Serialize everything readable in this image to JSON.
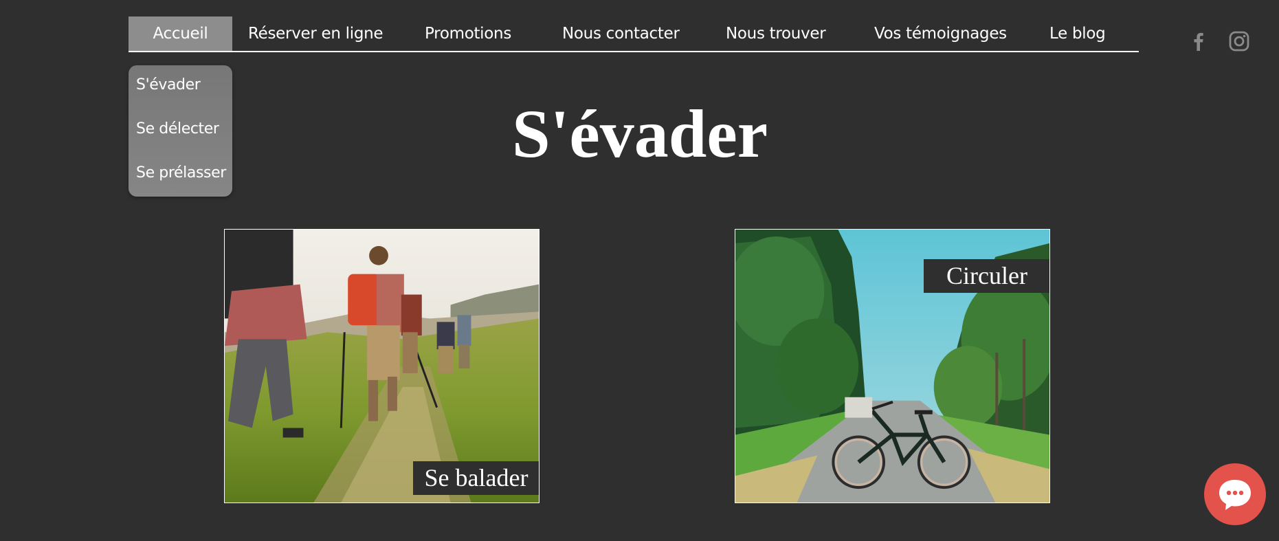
{
  "nav": {
    "items": [
      {
        "label": "Accueil",
        "active": true
      },
      {
        "label": "Réserver en ligne"
      },
      {
        "label": "Promotions"
      },
      {
        "label": "Nous contacter"
      },
      {
        "label": "Nous trouver"
      },
      {
        "label": "Vos témoignages"
      },
      {
        "label": "Le blog"
      }
    ]
  },
  "submenu": {
    "items": [
      {
        "label": "S'évader"
      },
      {
        "label": "Se délecter"
      },
      {
        "label": "Se prélasser"
      }
    ]
  },
  "social": {
    "icons": [
      "facebook-icon",
      "instagram-icon"
    ],
    "color": "#8a8a8a"
  },
  "page": {
    "title": "S'évader"
  },
  "cards": [
    {
      "label": "Se balader",
      "image": "hikers-on-trail-photo"
    },
    {
      "label": "Circuler",
      "image": "bicycle-on-forest-road-photo"
    }
  ],
  "colors": {
    "background": "#302f30",
    "nav_active": "#8d8d8d",
    "chat_button": "#e4534b"
  }
}
